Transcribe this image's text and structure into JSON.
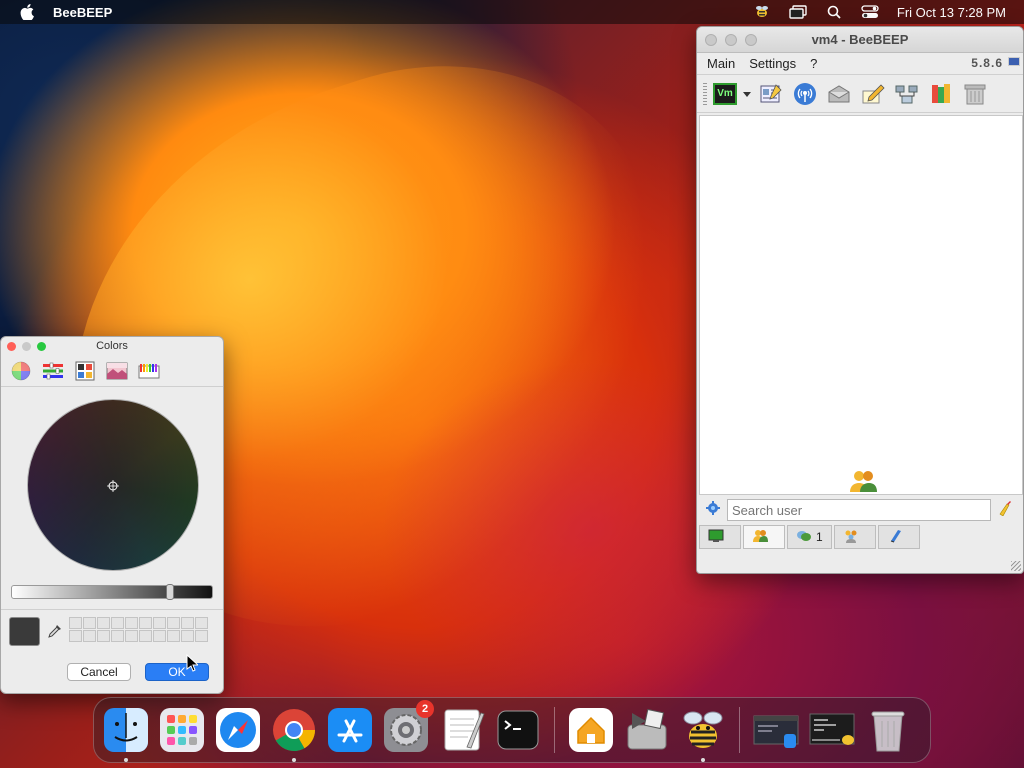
{
  "menubar": {
    "app_name": "BeeBEEP",
    "datetime": "Fri Oct 13  7:28 PM",
    "icons": [
      "apple-icon",
      "beebeep-status-icon",
      "screen-mirror-icon",
      "spotlight-search-icon",
      "control-center-icon"
    ]
  },
  "beebeep": {
    "title": "vm4 - BeeBEEP",
    "menu": [
      "Main",
      "Settings",
      "?"
    ],
    "version": "5.8.6",
    "toolbar_vm_label": "Vm",
    "toolbar_icons": [
      "status-icon",
      "edit-profile-icon",
      "broadcast-icon",
      "mail-icon",
      "write-message-icon",
      "network-icon",
      "files-icon",
      "trash-icon"
    ],
    "search_placeholder": "Search user",
    "tabs": [
      {
        "icon": "screen-icon",
        "label": ""
      },
      {
        "icon": "users-icon",
        "label": ""
      },
      {
        "icon": "chat-icon",
        "label": "1"
      },
      {
        "icon": "groups-icon",
        "label": ""
      },
      {
        "icon": "files-icon",
        "label": ""
      }
    ]
  },
  "colors_panel": {
    "title": "Colors",
    "modes": [
      "color-wheel-icon",
      "color-sliders-icon",
      "color-palettes-icon",
      "image-palettes-icon",
      "pencils-icon"
    ],
    "brightness": 0.8,
    "current_color": "#3a3a3a",
    "cancel_label": "Cancel",
    "ok_label": "OK"
  },
  "dock": {
    "items": [
      {
        "name": "finder-icon",
        "running": true
      },
      {
        "name": "launchpad-icon",
        "running": false
      },
      {
        "name": "safari-icon",
        "running": false
      },
      {
        "name": "chrome-icon",
        "running": true
      },
      {
        "name": "app-store-icon",
        "running": false
      },
      {
        "name": "system-settings-icon",
        "running": false,
        "badge": "2"
      },
      {
        "name": "textedit-icon",
        "running": false
      },
      {
        "name": "terminal-icon",
        "running": false
      },
      {
        "name": "home-icon",
        "running": false
      },
      {
        "name": "boot-camp-icon",
        "running": false
      },
      {
        "name": "beebeep-icon",
        "running": true
      },
      {
        "name": "recent-window-1-icon",
        "running": false
      },
      {
        "name": "recent-window-2-icon",
        "running": false
      },
      {
        "name": "trash-icon",
        "running": false
      }
    ]
  }
}
